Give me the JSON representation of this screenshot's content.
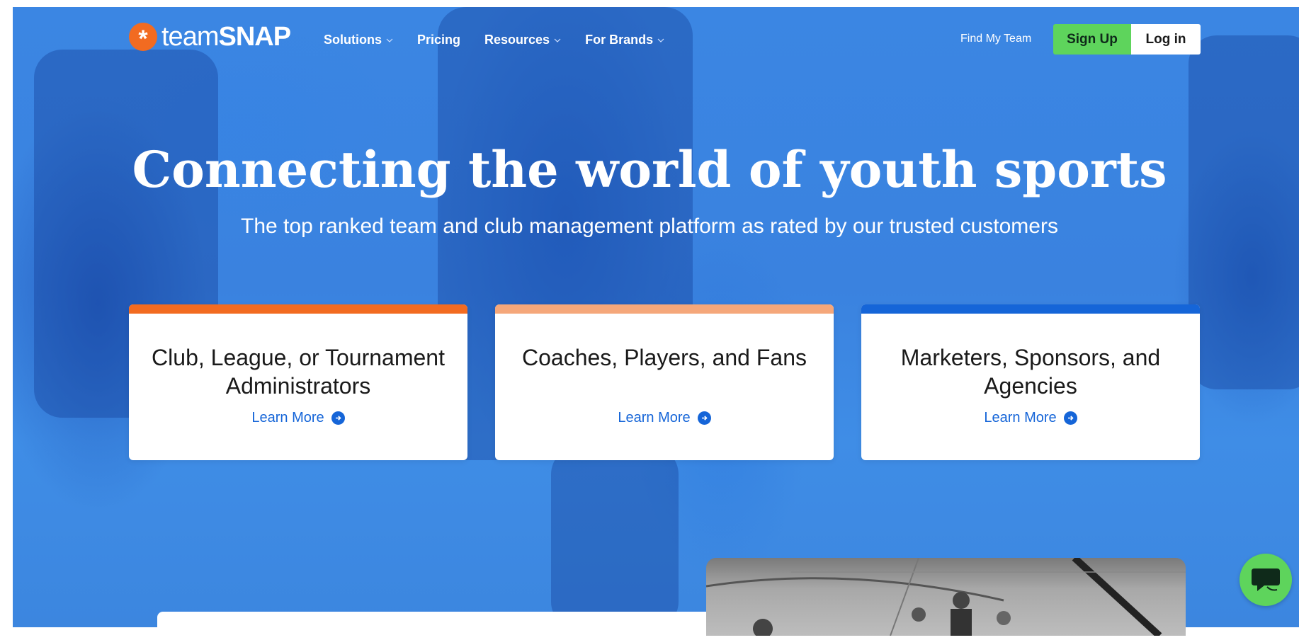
{
  "header": {
    "logo": {
      "team": "team",
      "snap": "SNAP"
    },
    "nav": [
      {
        "label": "Solutions",
        "has_dropdown": true
      },
      {
        "label": "Pricing",
        "has_dropdown": false
      },
      {
        "label": "Resources",
        "has_dropdown": true
      },
      {
        "label": "For Brands",
        "has_dropdown": true
      }
    ],
    "find_my_team": "Find My Team",
    "sign_up": "Sign Up",
    "log_in": "Log in"
  },
  "hero": {
    "title": "Connecting the world of youth sports",
    "subtitle": "The top ranked team and club management platform as rated by our trusted customers"
  },
  "cards": [
    {
      "title": "Club, League, or Tournament Administrators",
      "link": "Learn More",
      "accent": "#f26b21"
    },
    {
      "title": "Coaches, Players, and Fans",
      "link": "Learn More",
      "accent": "#f5a77a"
    },
    {
      "title": "Marketers, Sponsors, and Agencies",
      "link": "Learn More",
      "accent": "#1565d8"
    }
  ],
  "colors": {
    "brand_orange": "#f26b21",
    "brand_green": "#5ed45c",
    "link_blue": "#1565d8",
    "hero_blue": "#3b86e3"
  },
  "icons": {
    "logo": "asterisk-logo-icon",
    "chevron": "chevron-down-icon",
    "arrow": "arrow-right-circle-icon",
    "chat": "chat-bubble-icon"
  }
}
